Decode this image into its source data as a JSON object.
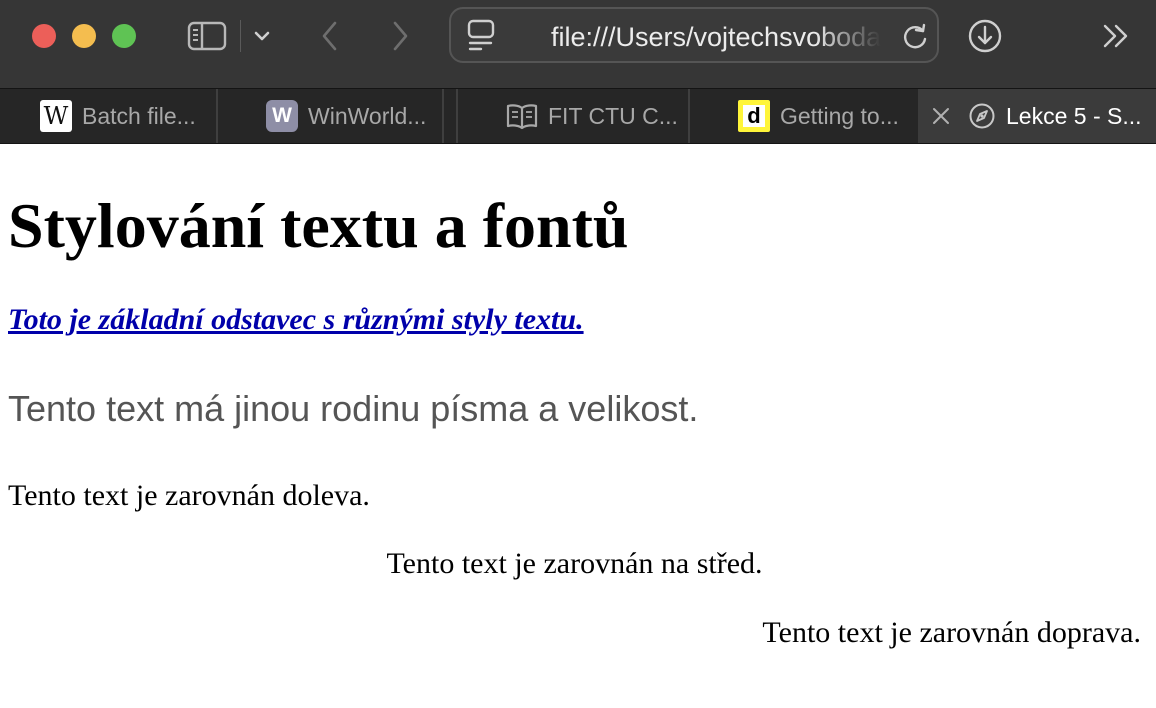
{
  "browser": {
    "address_bar": {
      "url": "file:///Users/vojtechsvoboda"
    },
    "icons": {
      "sidebar": "sidebar-icon",
      "sidebar_menu": "chevron-down-icon",
      "back": "chevron-left-icon",
      "forward": "chevron-right-icon",
      "page_menu": "page-menu-icon",
      "reload": "reload-icon",
      "downloads": "download-icon",
      "overflow": "double-chevron-right-icon"
    }
  },
  "tabs": [
    {
      "label": "Batch file...",
      "favicon": "W",
      "favicon_name": "wikipedia-icon",
      "active": false
    },
    {
      "label": "WinWorld...",
      "favicon": "W",
      "favicon_name": "winworld-icon",
      "active": false
    },
    {
      "label": "FIT CTU C...",
      "favicon": "",
      "favicon_name": "book-icon",
      "active": false
    },
    {
      "label": "Getting to...",
      "favicon": "d",
      "favicon_name": "dev-icon",
      "active": false
    },
    {
      "label": "Lekce 5 - S...",
      "favicon": "",
      "favicon_name": "compass-icon",
      "active": true
    }
  ],
  "page": {
    "heading": "Stylování textu a fontů",
    "styled_paragraph": "Toto je základní odstavec s různými styly textu.",
    "font_family_paragraph": "Tento text má jinou rodinu písma a velikost.",
    "left_aligned": "Tento text je zarovnán doleva.",
    "center_aligned": "Tento text je zarovnán na střed.",
    "right_aligned": "Tento text je zarovnán doprava."
  },
  "colors": {
    "toolbar_bg": "#363636",
    "tabstrip_bg": "#262626",
    "active_tab_bg": "#3b3b3b",
    "link": "#0000aa",
    "gray_text": "#555555",
    "close": "#ec5f59",
    "minimize": "#f4bd4f",
    "zoom": "#5fc354"
  }
}
